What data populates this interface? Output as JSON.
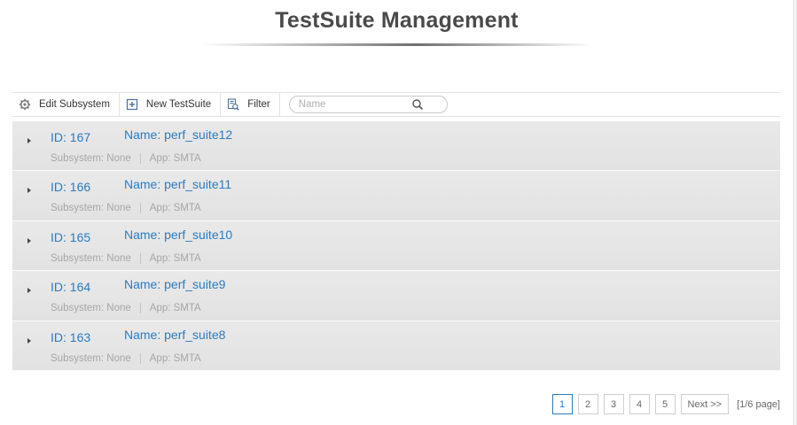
{
  "page": {
    "title": "TestSuite Management"
  },
  "toolbar": {
    "edit_subsystem": "Edit Subsystem",
    "new_testsuite": "New TestSuite",
    "filter": "Filter",
    "search_placeholder": "Name"
  },
  "rows": [
    {
      "id": "ID: 167",
      "name": "Name: perf_suite12",
      "subsystem": "Subsystem: None",
      "app": "App: SMTA"
    },
    {
      "id": "ID: 166",
      "name": "Name: perf_suite11",
      "subsystem": "Subsystem: None",
      "app": "App: SMTA"
    },
    {
      "id": "ID: 165",
      "name": "Name: perf_suite10",
      "subsystem": "Subsystem: None",
      "app": "App: SMTA"
    },
    {
      "id": "ID: 164",
      "name": "Name: perf_suite9",
      "subsystem": "Subsystem: None",
      "app": "App: SMTA"
    },
    {
      "id": "ID: 163",
      "name": "Name: perf_suite8",
      "subsystem": "Subsystem: None",
      "app": "App: SMTA"
    }
  ],
  "pagination": {
    "pages": [
      "1",
      "2",
      "3",
      "4",
      "5"
    ],
    "current": "1",
    "next_label": "Next >>",
    "info": "[1/6 page]"
  },
  "icons": {
    "edit_subsystem": "gear-icon",
    "new_testsuite": "plus-box-icon",
    "filter": "filter-icon",
    "search": "search-icon",
    "row_expand": "caret-right-icon"
  },
  "colors": {
    "link": "#2a7bc0",
    "row_bg": "#e4e4e4",
    "meta_text": "#a6a6a6"
  }
}
